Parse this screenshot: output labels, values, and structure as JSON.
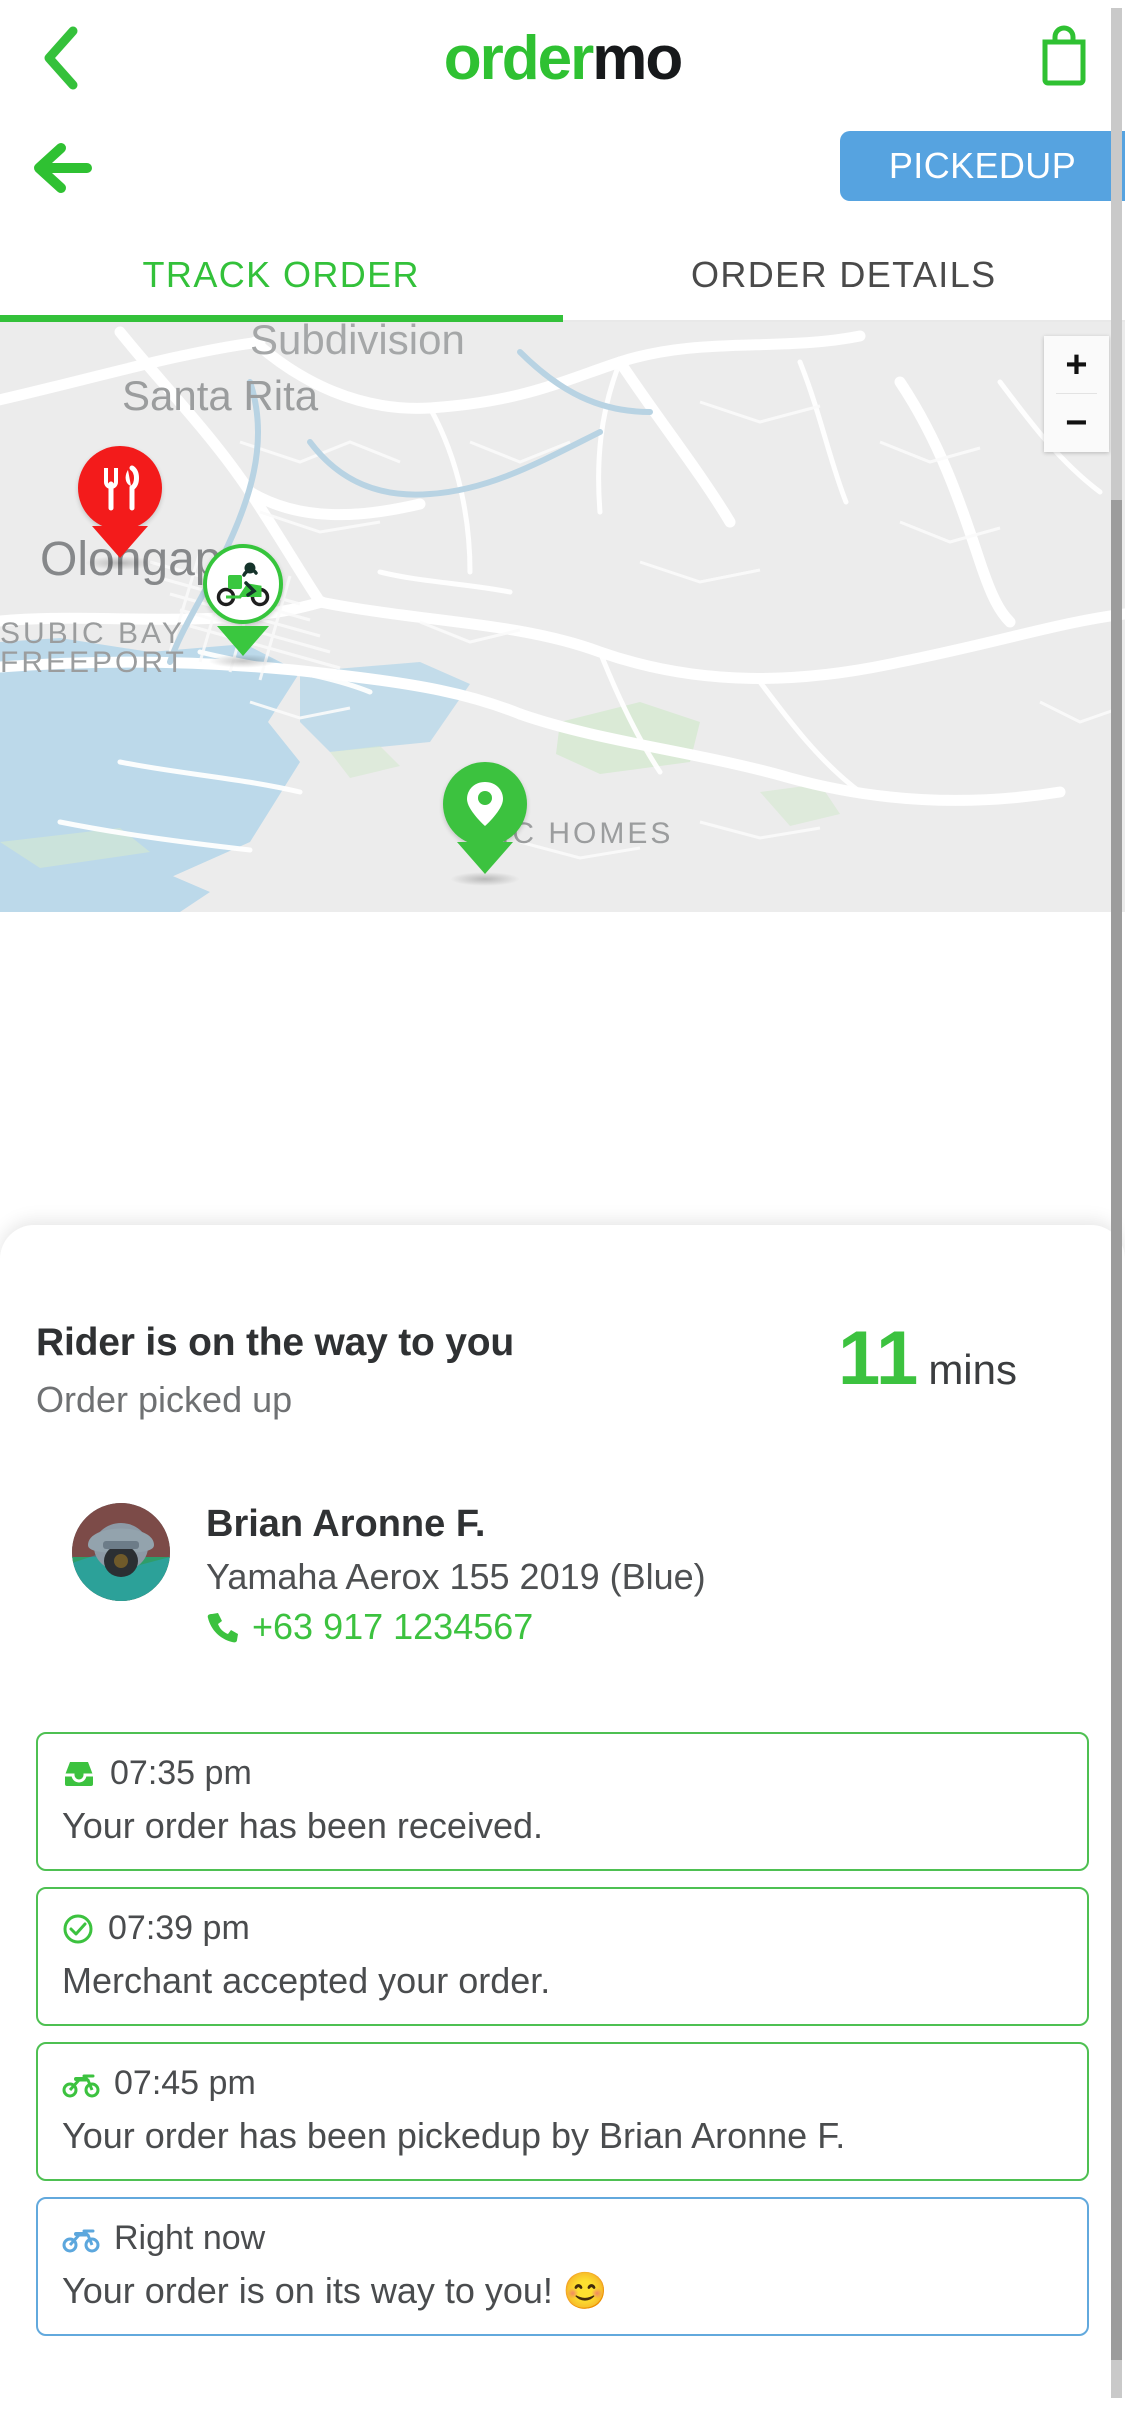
{
  "app": {
    "brand_green": "order",
    "brand_black": "mo",
    "accent_color": "#3cc23f",
    "status_color": "#56a3e0"
  },
  "header": {
    "back_chevron_icon": "chevron-left-icon",
    "cart_icon": "shopping-bag-icon",
    "back_arrow_icon": "arrow-left-icon",
    "status_label": "PICKEDUP"
  },
  "tabs": [
    {
      "label": "TRACK ORDER",
      "active": true
    },
    {
      "label": "ORDER DETAILS",
      "active": false
    }
  ],
  "map": {
    "labels": {
      "subdivision": "Subdivision",
      "santa_rita": "Santa Rita",
      "olongapo": "Olongapo",
      "subic_bay": "SUBIC BAY",
      "freeport": "FREEPORT",
      "subic_homes": "BIC HOMES"
    },
    "zoom_in": "+",
    "zoom_out": "−",
    "markers": {
      "restaurant": "restaurant-marker-icon",
      "rider": "rider-scooter-marker-icon",
      "destination": "destination-pin-marker-icon"
    }
  },
  "eta": {
    "title": "Rider is on the way to you",
    "subtitle": "Order picked up",
    "value": "11",
    "unit": "mins"
  },
  "rider": {
    "name": "Brian Aronne F.",
    "vehicle": "Yamaha Aerox 155 2019 (Blue)",
    "phone": "+63 917 1234567",
    "phone_icon": "phone-icon",
    "avatar_icon": "rider-avatar"
  },
  "timeline": [
    {
      "icon": "inbox-tray-icon",
      "time": "07:35 pm",
      "text": "Your order has been received.",
      "color": "green"
    },
    {
      "icon": "check-circle-icon",
      "time": "07:39 pm",
      "text": "Merchant accepted your order.",
      "color": "green"
    },
    {
      "icon": "motorcycle-icon",
      "time": "07:45 pm",
      "text": "Your order has been pickedup by Brian Aronne F.",
      "color": "green"
    },
    {
      "icon": "motorcycle-icon",
      "time": "Right now",
      "text": "Your order is on its way to you! 😊",
      "color": "blue"
    }
  ]
}
